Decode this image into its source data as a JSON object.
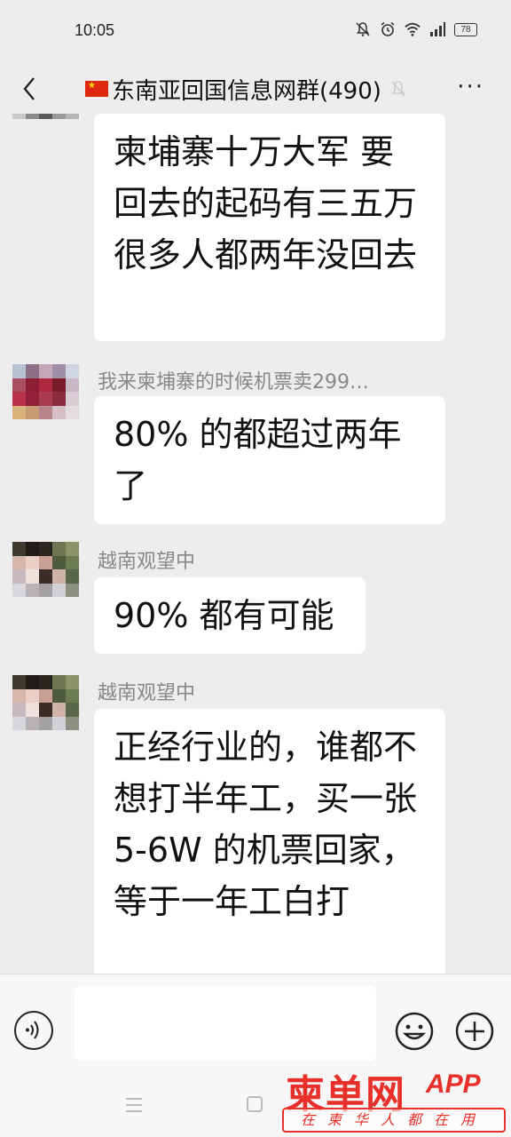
{
  "status_bar": {
    "time": "10:05",
    "icons": [
      "mute-bell-icon",
      "alarm-icon",
      "wifi-icon",
      "signal-icon"
    ],
    "battery": "78"
  },
  "header": {
    "flag_icon": "china-flag-icon",
    "title": "东南亚回国信息网群(490)",
    "more_label": "···"
  },
  "messages": [
    {
      "sender": "",
      "text": "柬埔寨十万大军 要回去的起码有三五万 很多人都两年没回去"
    },
    {
      "sender": "我来柬埔寨的时候机票卖299…",
      "text": "80% 的都超过两年了"
    },
    {
      "sender": "越南观望中",
      "text": "90% 都有可能"
    },
    {
      "sender": "越南观望中",
      "text": "正经行业的，谁都不想打半年工，买一张 5-6W 的机票回家，等于一年工白打"
    }
  ],
  "input_bar": {
    "voice_icon": "voice-icon",
    "emoji_icon": "emoji-icon",
    "plus_icon": "plus-icon"
  },
  "watermark": {
    "logo": "柬单网",
    "app": "APP",
    "tagline": "在柬华人都在用"
  },
  "colors": {
    "background": "#ededed",
    "bubble": "#ffffff",
    "brand_red": "#e8302a"
  }
}
